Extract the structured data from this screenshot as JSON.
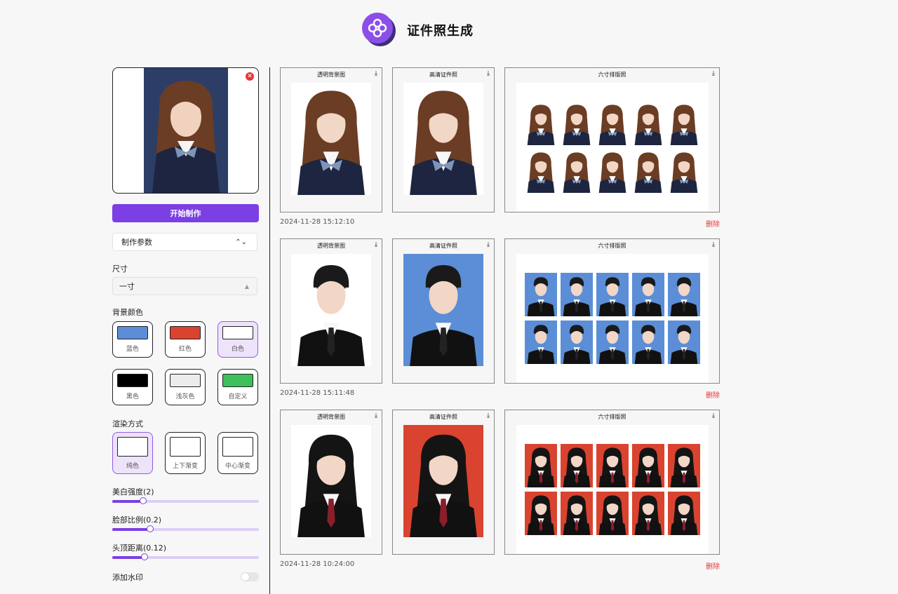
{
  "app": {
    "title": "证件照生成"
  },
  "left_panel": {
    "start_button": "开始制作",
    "params_label": "制作参数",
    "size_label": "尺寸",
    "size_value": "一寸",
    "bg_label": "背景颜色",
    "bg_options": [
      {
        "label": "蓝色",
        "color": "#5b8ed6",
        "selected": false
      },
      {
        "label": "红色",
        "color": "#d9432f",
        "selected": false
      },
      {
        "label": "白色",
        "color": "#ffffff",
        "selected": true
      },
      {
        "label": "黑色",
        "color": "#000000",
        "selected": false
      },
      {
        "label": "浅灰色",
        "color": "#ececec",
        "selected": false
      },
      {
        "label": "自定义",
        "color": "#3fbf59",
        "selected": false
      }
    ],
    "render_label": "渲染方式",
    "render_options": [
      {
        "label": "纯色",
        "selected": true
      },
      {
        "label": "上下渐变",
        "selected": false
      },
      {
        "label": "中心渐变",
        "selected": false
      }
    ],
    "sliders": [
      {
        "label": "美白强度(2)",
        "fraction": 0.21
      },
      {
        "label": "脸部比例(0.2)",
        "fraction": 0.26
      },
      {
        "label": "头顶距离(0.12)",
        "fraction": 0.22
      }
    ],
    "watermark_label": "添加水印",
    "watermark_on": false
  },
  "history": {
    "card_titles": {
      "transparent": "透明背景图",
      "hd": "高清证件照",
      "layout": "六寸排版照"
    },
    "delete_label": "删除",
    "records": [
      {
        "timestamp": "2024-11-28 15:12:10",
        "bg_color": "#ffffff",
        "person": "girl-long-hair"
      },
      {
        "timestamp": "2024-11-28 15:11:48",
        "bg_color": "#5b8ed6",
        "person": "boy-suit"
      },
      {
        "timestamp": "2024-11-28 10:24:00",
        "bg_color": "#d9432f",
        "person": "woman-suit"
      }
    ]
  },
  "colors": {
    "accent": "#7b3fe4",
    "delete": "#e53935",
    "upload_bg": "#2c3e66"
  }
}
